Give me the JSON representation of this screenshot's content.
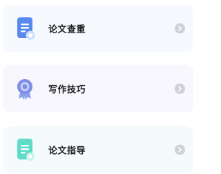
{
  "colors": {
    "card_1_bg": "#f6f9fe",
    "card_2_bg": "#f7f7fd",
    "card_3_bg": "#f5fbfc",
    "icon_blue": "#5b8cf0",
    "icon_purple": "#7d8ee6",
    "icon_teal": "#5fdcc8",
    "chevron_bg": "#cfd1d6"
  },
  "menu": {
    "items": [
      {
        "label": "论文查重",
        "icon": "document-check-icon"
      },
      {
        "label": "写作技巧",
        "icon": "award-badge-icon"
      },
      {
        "label": "论文指导",
        "icon": "document-guide-icon"
      }
    ]
  }
}
